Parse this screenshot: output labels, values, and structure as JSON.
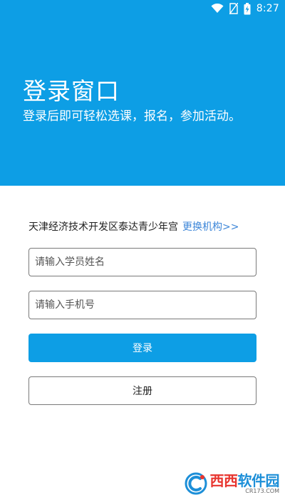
{
  "status_bar": {
    "time": "8:27",
    "icons": [
      "wifi-icon",
      "no-sim-icon",
      "battery-charging-icon"
    ]
  },
  "header": {
    "title": "登录窗口",
    "subtitle": "登录后即可轻松选课，报名，参加活动。",
    "background_color": "#0d9ee5"
  },
  "org": {
    "name": "天津经济技术开发区泰达青少年宫",
    "change_link": "更换机构>>",
    "link_color": "#3d86d8"
  },
  "form": {
    "name_placeholder": "请输入学员姓名",
    "name_value": "",
    "phone_placeholder": "请输入手机号",
    "phone_value": "",
    "login_label": "登录",
    "register_label": "注册"
  },
  "watermark": {
    "main_part1": "西西",
    "main_part2": "软件园",
    "sub": "CR173.COM"
  }
}
